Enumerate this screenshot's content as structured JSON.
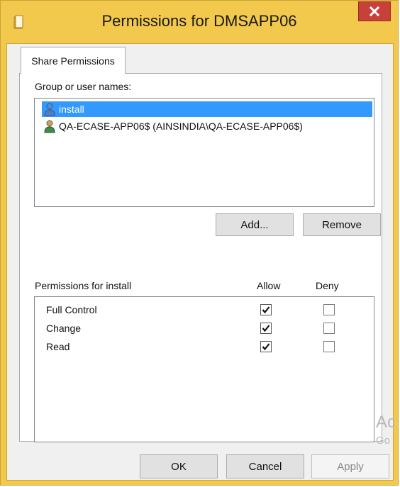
{
  "window": {
    "title": "Permissions for DMSAPP06",
    "close_symbol": "x"
  },
  "tabs": [
    {
      "label": "Share Permissions",
      "selected": true
    }
  ],
  "group_section": {
    "label": "Group or user names:",
    "users": [
      {
        "name": "install",
        "icon": "user-icon",
        "selected": true
      },
      {
        "name": "QA-ECASE-APP06$ (AINSINDIA\\QA-ECASE-APP06$)",
        "icon": "computer-user-icon",
        "selected": false
      }
    ],
    "add_label": "Add...",
    "remove_label": "Remove"
  },
  "permissions_section": {
    "label": "Permissions for install",
    "allow_header": "Allow",
    "deny_header": "Deny",
    "rows": [
      {
        "name": "Full Control",
        "allow": true,
        "deny": false
      },
      {
        "name": "Change",
        "allow": true,
        "deny": false
      },
      {
        "name": "Read",
        "allow": true,
        "deny": false
      }
    ]
  },
  "buttons": {
    "ok": "OK",
    "cancel": "Cancel",
    "apply": "Apply",
    "apply_disabled": true
  },
  "watermark": {
    "line1": "Ac",
    "line2": "Go"
  },
  "colors": {
    "frame": "#f2c94c",
    "close": "#c7403a",
    "selection": "#3399ff"
  }
}
